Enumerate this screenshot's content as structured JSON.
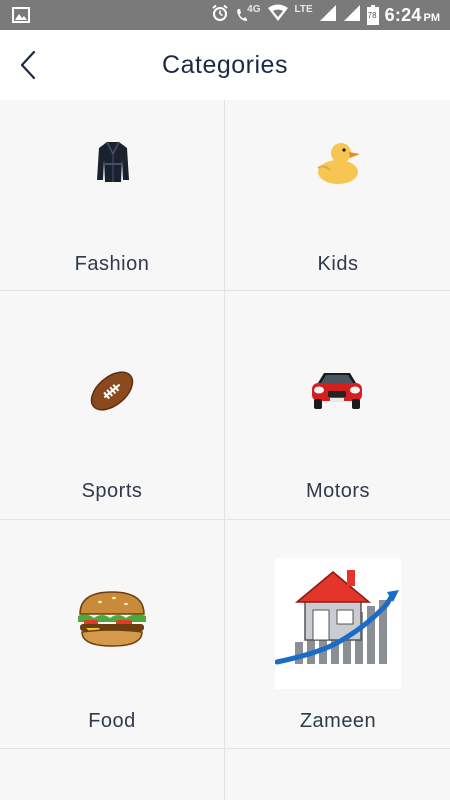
{
  "status_bar": {
    "network_4g": "4G",
    "network_lte": "LTE",
    "battery_level": "78",
    "time": "6:24",
    "ampm": "PM"
  },
  "header": {
    "title": "Categories",
    "back_icon": "chevron-left-icon"
  },
  "categories": [
    {
      "label": "Fashion",
      "icon": "coat-icon"
    },
    {
      "label": "Kids",
      "icon": "rubber-duck-icon"
    },
    {
      "label": "Sports",
      "icon": "football-icon"
    },
    {
      "label": "Motors",
      "icon": "car-icon"
    },
    {
      "label": "Food",
      "icon": "burger-icon"
    },
    {
      "label": "Zameen",
      "icon": "house-growth-icon"
    }
  ],
  "colors": {
    "status_bar": "#7a7a7a",
    "title": "#1d2a45",
    "label": "#2f3a4c",
    "divider": "#e2e2e2",
    "background": "#f7f7f7"
  }
}
